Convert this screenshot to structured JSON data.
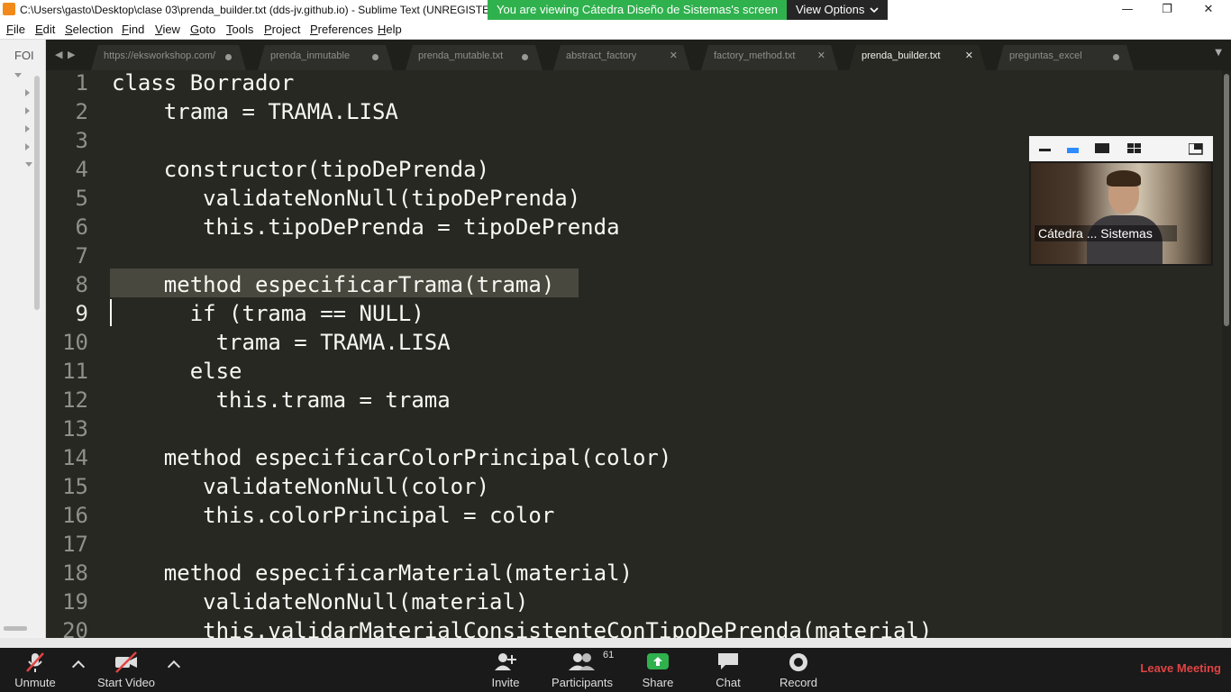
{
  "window": {
    "title": "C:\\Users\\gasto\\Desktop\\clase 03\\prenda_builder.txt (dds-jv.github.io) - Sublime Text (UNREGISTER",
    "controls": {
      "minimize": "—",
      "restore": "❐",
      "close": "✕"
    }
  },
  "zoom_banner": {
    "message": "You are viewing Cátedra Diseño de Sistemas's screen",
    "view_options": "View Options"
  },
  "menu": [
    "File",
    "Edit",
    "Selection",
    "Find",
    "View",
    "Goto",
    "Tools",
    "Project",
    "Preferences",
    "Help"
  ],
  "sidebar": {
    "label": "FOI"
  },
  "tabs": [
    {
      "label": "https://eksworkshop.com/",
      "state": "modified"
    },
    {
      "label": "prenda_inmutable",
      "state": "modified"
    },
    {
      "label": "prenda_mutable.txt",
      "state": "modified"
    },
    {
      "label": "abstract_factory",
      "state": "close"
    },
    {
      "label": "factory_method.txt",
      "state": "close"
    },
    {
      "label": "prenda_builder.txt",
      "state": "active"
    },
    {
      "label": "preguntas_excel",
      "state": "modified"
    }
  ],
  "editor": {
    "lines": [
      {
        "n": "1",
        "text": "class Borrador"
      },
      {
        "n": "2",
        "text": "    trama = TRAMA.LISA"
      },
      {
        "n": "3",
        "text": ""
      },
      {
        "n": "4",
        "text": "    constructor(tipoDePrenda)"
      },
      {
        "n": "5",
        "text": "       validateNonNull(tipoDePrenda)"
      },
      {
        "n": "6",
        "text": "       this.tipoDePrenda = tipoDePrenda"
      },
      {
        "n": "7",
        "text": ""
      },
      {
        "n": "8",
        "text": "    method especificarTrama(trama)"
      },
      {
        "n": "9",
        "text": "      if (trama == NULL)"
      },
      {
        "n": "10",
        "text": "        trama = TRAMA.LISA"
      },
      {
        "n": "11",
        "text": "      else"
      },
      {
        "n": "12",
        "text": "        this.trama = trama"
      },
      {
        "n": "13",
        "text": ""
      },
      {
        "n": "14",
        "text": "    method especificarColorPrincipal(color)"
      },
      {
        "n": "15",
        "text": "       validateNonNull(color)"
      },
      {
        "n": "16",
        "text": "       this.colorPrincipal = color"
      },
      {
        "n": "17",
        "text": ""
      },
      {
        "n": "18",
        "text": "    method especificarMaterial(material)"
      },
      {
        "n": "19",
        "text": "       validateNonNull(material)"
      },
      {
        "n": "20",
        "text": "       this.validarMaterialConsistenteConTipoDePrenda(material)"
      }
    ]
  },
  "video": {
    "name": "Cátedra ... Sistemas"
  },
  "zoom_controls": {
    "unmute": "Unmute",
    "start_video": "Start Video",
    "invite": "Invite",
    "participants": "Participants",
    "participants_count": "61",
    "share": "Share",
    "chat": "Chat",
    "record": "Record",
    "leave": "Leave Meeting"
  },
  "colors": {
    "banner_green": "#2fb14d",
    "leave_red": "#e04343",
    "editor_bg": "#272822"
  }
}
